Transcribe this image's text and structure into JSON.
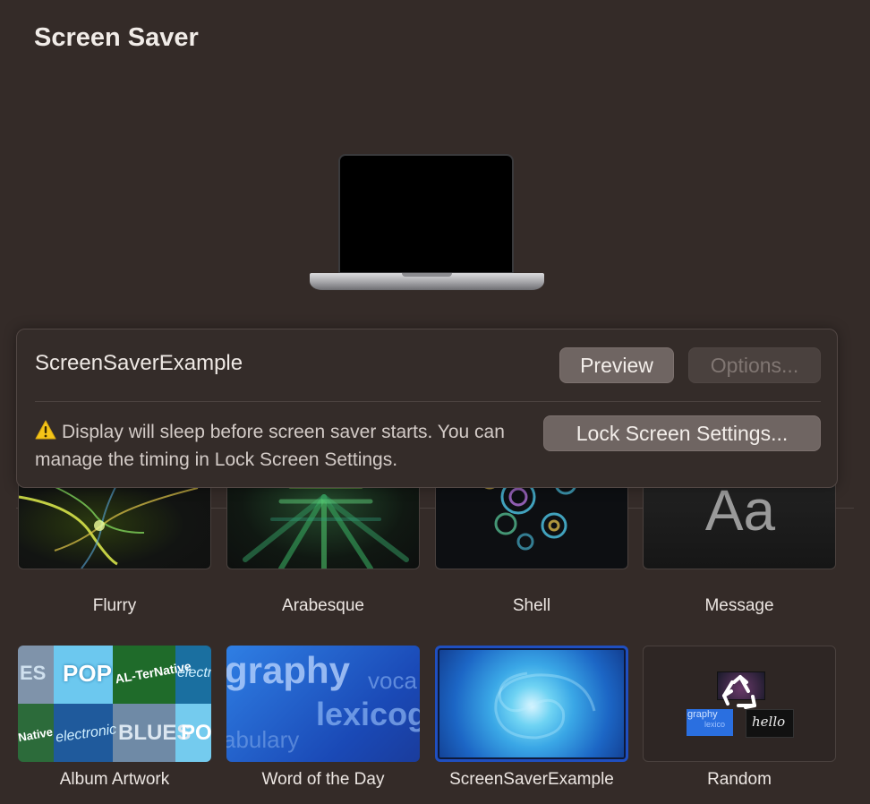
{
  "header": {
    "title": "Screen Saver"
  },
  "panel": {
    "selected_name": "ScreenSaverExample",
    "preview_label": "Preview",
    "options_label": "Options...",
    "warning_text": "Display will sleep before screen saver starts. You can manage the timing in Lock Screen Settings.",
    "lock_settings_label": "Lock Screen Settings..."
  },
  "savers": [
    {
      "label": "Flurry"
    },
    {
      "label": "Arabesque"
    },
    {
      "label": "Shell"
    },
    {
      "label": "Message",
      "thumb_text": "Aa"
    },
    {
      "label": "Album Artwork",
      "thumb_words": [
        "ES",
        "POP",
        "AL-TerNative",
        "electr",
        "Native",
        "electronic",
        "BLUES",
        "PO"
      ]
    },
    {
      "label": "Word of the Day",
      "thumb_words": [
        "graphy",
        "voca",
        "lexicog",
        "abulary"
      ]
    },
    {
      "label": "ScreenSaverExample",
      "selected": true
    },
    {
      "label": "Random",
      "thumb_words": [
        "graphy",
        "lexico",
        "hello"
      ]
    }
  ],
  "colors": {
    "background": "#342b28",
    "selection_border": "#1f4fc0",
    "warning_icon": "#f5c518"
  },
  "icons": [
    "warning-icon",
    "recycle-icon"
  ]
}
